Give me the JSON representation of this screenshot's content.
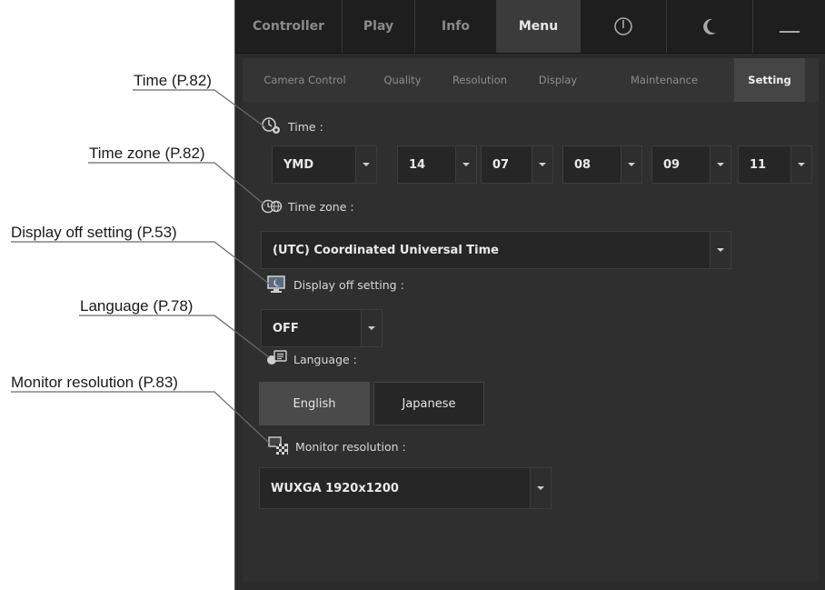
{
  "callouts": {
    "time": "Time (P.82)",
    "time_zone": "Time zone (P.82)",
    "display_off": "Display off setting (P.53)",
    "language": "Language (P.78)",
    "monitor_resolution": "Monitor resolution (P.83)"
  },
  "top_tabs": {
    "controller": "Controller",
    "play": "Play",
    "info": "Info",
    "menu": "Menu",
    "power_icon": "power-icon",
    "sleep_icon": "moon-icon",
    "minimize_icon": "minimize-icon"
  },
  "sub_tabs": {
    "camera_control": "Camera Control",
    "quality": "Quality",
    "resolution": "Resolution",
    "display": "Display",
    "maintenance": "Maintenance",
    "setting": "Setting"
  },
  "time": {
    "label": "Time :",
    "format": "YMD",
    "year": "14",
    "month": "07",
    "day": "08",
    "hour": "09",
    "minute": "11"
  },
  "time_zone": {
    "label": "Time zone :",
    "value": "(UTC) Coordinated Universal Time"
  },
  "display_off": {
    "label": "Display off setting :",
    "value": "OFF"
  },
  "language": {
    "label": "Language :",
    "options": [
      "English",
      "Japanese"
    ],
    "selected": "English"
  },
  "monitor_resolution": {
    "label": "Monitor resolution :",
    "value": "WUXGA 1920x1200"
  },
  "colors": {
    "panel_bg": "#2b2b2b",
    "active_tab": "#3b3b3b",
    "dropdown_bg": "#262626"
  }
}
